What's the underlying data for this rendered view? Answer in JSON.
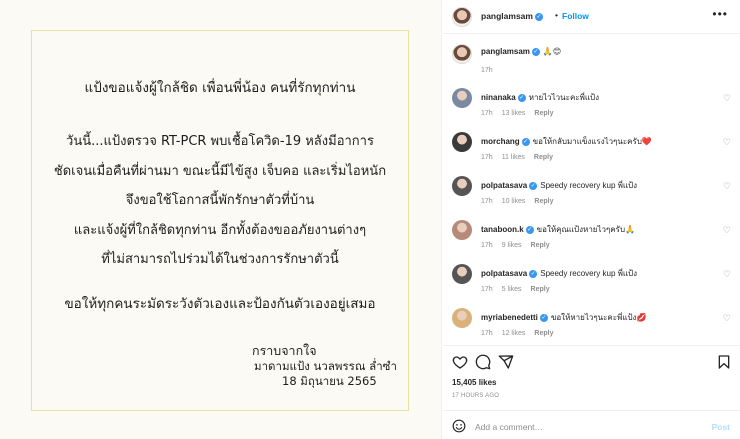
{
  "letter": {
    "line1": "แป้งขอแจ้งผู้ใกล้ชิด เพื่อนพี่น้อง คนที่รักทุกท่าน",
    "line2": "วันนี้...แป้งตรวจ RT-PCR พบเชื้อโควิด-19 หลังมีอาการ",
    "line3": "ชัดเจนเมื่อคืนที่ผ่านมา ขณะนี้มีไข้สูง เจ็บคอ และเริ่มไอหนัก",
    "line4": "จึงขอใช้โอกาสนี้พักรักษาตัวที่บ้าน",
    "line5": "และแจ้งผู้ที่ใกล้ชิดทุกท่าน อีกทั้งต้องขออภัยงานต่างๆ",
    "line6": "ที่ไม่สามารถไปร่วมได้ในช่วงการรักษาตัวนี้",
    "line7": "ขอให้ทุกคนระมัดระวังตัวเองและป้องกันตัวเองอยู่เสมอ",
    "sign1": "กราบจากใจ",
    "sign2": "มาดามแป้ง นวลพรรณ ล่ำซำ",
    "sign3": "18 มิถุนายน 2565"
  },
  "header": {
    "username": "panglamsam",
    "separator": "•",
    "follow_label": "Follow",
    "more_label": "•••"
  },
  "caption": {
    "username": "panglamsam",
    "text": "🙏😊",
    "time": "17h"
  },
  "comments": [
    {
      "username": "ninanaka",
      "text": "หายไวไวนะคะพี่แป้ง",
      "time": "17h",
      "likes": "13 likes",
      "reply": "Reply",
      "avatar_color": "#7a8aa0"
    },
    {
      "username": "morchang",
      "text": "ขอให้กลับมาแข็งแรงไวๆนะครับ❤️",
      "time": "17h",
      "likes": "11 likes",
      "reply": "Reply",
      "avatar_color": "#3a3a3a"
    },
    {
      "username": "polpatasava",
      "text": "Speedy recovery kup พี่แป้ง",
      "time": "17h",
      "likes": "10 likes",
      "reply": "Reply",
      "avatar_color": "#555555"
    },
    {
      "username": "tanaboon.k",
      "text": "ขอให้คุณแป้งหายไวๆครับ🙏",
      "time": "17h",
      "likes": "9 likes",
      "reply": "Reply",
      "avatar_color": "#b58a78"
    },
    {
      "username": "polpatasava",
      "text": "Speedy recovery kup พี่แป้ง",
      "time": "17h",
      "likes": "5 likes",
      "reply": "Reply",
      "avatar_color": "#555555"
    },
    {
      "username": "myriabenedetti",
      "text": "ขอให้หายไวๆนะคะพี่แป้ง💋",
      "time": "17h",
      "likes": "12 likes",
      "reply": "Reply",
      "avatar_color": "#d9b27a"
    }
  ],
  "stats": {
    "likes": "15,405 likes",
    "ago": "17 HOURS AGO"
  },
  "add_comment": {
    "placeholder": "Add a comment…",
    "post_label": "Post"
  },
  "colors": {
    "accent": "#0095f6",
    "verified": "#3897f0",
    "letter_border": "#e8dfa3",
    "post_disabled": "#b2dffc"
  }
}
